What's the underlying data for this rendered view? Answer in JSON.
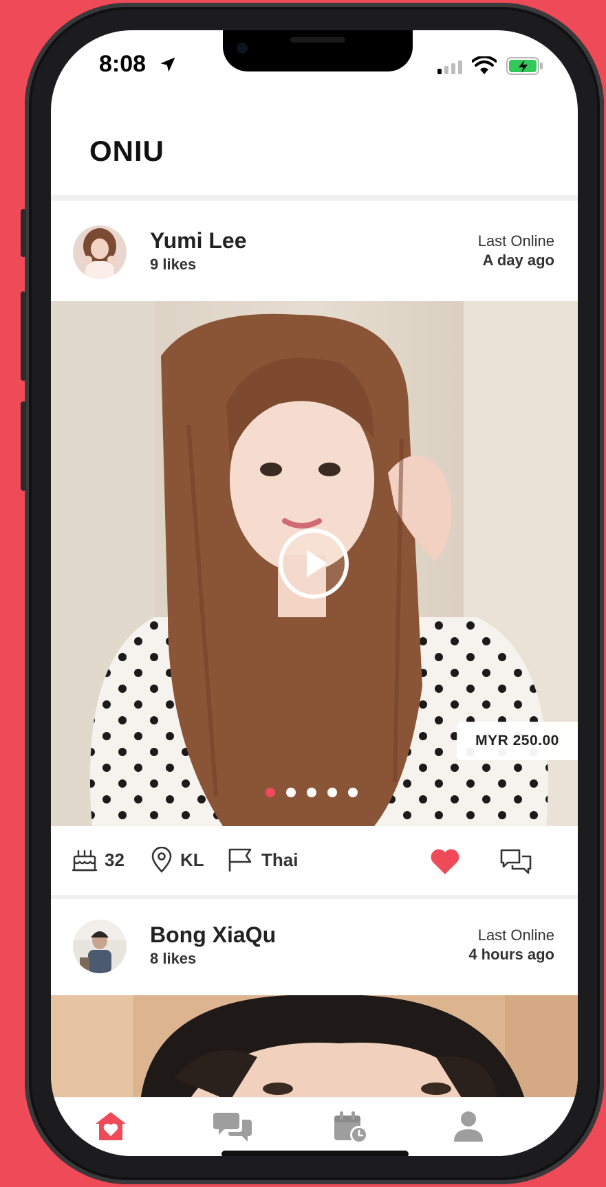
{
  "status_bar": {
    "time": "8:08"
  },
  "app": {
    "title": "ONIU"
  },
  "posts": [
    {
      "name": "Yumi Lee",
      "likes": "9 likes",
      "last_online_label": "Last Online",
      "last_online_value": "A day ago",
      "price": "MYR 250.00",
      "age": "32",
      "location": "KL",
      "nationality": "Thai",
      "carousel_count": 5,
      "carousel_active": 1
    },
    {
      "name": "Bong XiaQu",
      "likes": "8 likes",
      "last_online_label": "Last Online",
      "last_online_value": "4 hours ago"
    }
  ],
  "tabs": [
    {
      "name": "home",
      "icon": "home-heart-icon",
      "active": true
    },
    {
      "name": "messages",
      "icon": "chat-bubbles-icon",
      "active": false
    },
    {
      "name": "schedule",
      "icon": "calendar-clock-icon",
      "active": false
    },
    {
      "name": "profile",
      "icon": "user-icon",
      "active": false
    }
  ],
  "colors": {
    "accent": "#ee4a57",
    "inactive": "#9e9e9e"
  }
}
